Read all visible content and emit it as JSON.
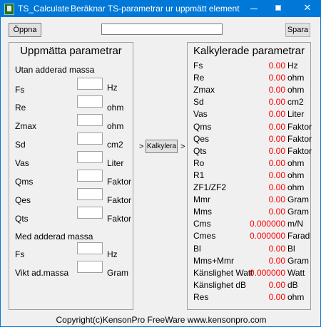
{
  "window": {
    "title": "TS_Calculate",
    "subtitle": "Beräknar TS-parametrar ur uppmätt element",
    "minimize_glyph": "",
    "close_glyph": "✕"
  },
  "toolbar": {
    "open_label": "Öppna",
    "save_label": "Spara",
    "file_value": ""
  },
  "left_panel": {
    "title": "Uppmätta parametrar",
    "section1": "Utan adderad massa",
    "section2": "Med adderad massa",
    "fields": [
      {
        "label": "Fs",
        "unit": "Hz",
        "value": ""
      },
      {
        "label": "Re",
        "unit": "ohm",
        "value": ""
      },
      {
        "label": "Zmax",
        "unit": "ohm",
        "value": ""
      },
      {
        "label": "Sd",
        "unit": "cm2",
        "value": ""
      },
      {
        "label": "Vas",
        "unit": "Liter",
        "value": ""
      },
      {
        "label": "Qms",
        "unit": "Faktor",
        "value": ""
      },
      {
        "label": "Qes",
        "unit": "Faktor",
        "value": ""
      },
      {
        "label": "Qts",
        "unit": "Faktor",
        "value": ""
      }
    ],
    "mass_fields": [
      {
        "label": "Fs",
        "unit": "Hz",
        "value": ""
      },
      {
        "label": "Vikt ad.massa",
        "unit": "Gram",
        "value": ""
      }
    ]
  },
  "calc": {
    "arrow_left": ">",
    "button_label": "Kalkylera",
    "arrow_right": ">"
  },
  "right_panel": {
    "title": "Kalkylerade parametrar",
    "rows": [
      {
        "label": "Fs",
        "value": "0.00",
        "unit": "Hz"
      },
      {
        "label": "Re",
        "value": "0.00",
        "unit": "ohm"
      },
      {
        "label": "Zmax",
        "value": "0.00",
        "unit": "ohm"
      },
      {
        "label": "Sd",
        "value": "0.00",
        "unit": "cm2"
      },
      {
        "label": "Vas",
        "value": "0.00",
        "unit": "Liter"
      },
      {
        "label": "Qms",
        "value": "0.00",
        "unit": "Faktor"
      },
      {
        "label": "Qes",
        "value": "0.00",
        "unit": "Faktor"
      },
      {
        "label": "Qts",
        "value": "0.00",
        "unit": "Faktor"
      },
      {
        "label": "Ro",
        "value": "0.00",
        "unit": "ohm"
      },
      {
        "label": "R1",
        "value": "0.00",
        "unit": "ohm"
      },
      {
        "label": "ZF1/ZF2",
        "value": "0.00",
        "unit": "ohm"
      },
      {
        "label": "Mmr",
        "value": "0.00",
        "unit": "Gram"
      },
      {
        "label": "Mms",
        "value": "0.00",
        "unit": "Gram"
      },
      {
        "label": "Cms",
        "value": "0.000000",
        "unit": "m/N"
      },
      {
        "label": "Cmes",
        "value": "0.000000",
        "unit": "Farad"
      },
      {
        "label": "Bl",
        "value": "0.00",
        "unit": "Bl"
      },
      {
        "label": "Mms+Mmr",
        "value": "0.00",
        "unit": "Gram"
      },
      {
        "label": "Känslighet Watt",
        "value": "0.000000",
        "unit": "Watt"
      },
      {
        "label": "Känslighet dB",
        "value": "0.00",
        "unit": "dB"
      },
      {
        "label": "Res",
        "value": "0.00",
        "unit": "ohm"
      }
    ]
  },
  "footer": {
    "text": "Copyright(c)KensonPro  FreeWare  www.kensonpro.com"
  },
  "colors": {
    "titlebar": "#0078d7",
    "value_red": "#ff0000",
    "background": "#f0f0f0"
  }
}
